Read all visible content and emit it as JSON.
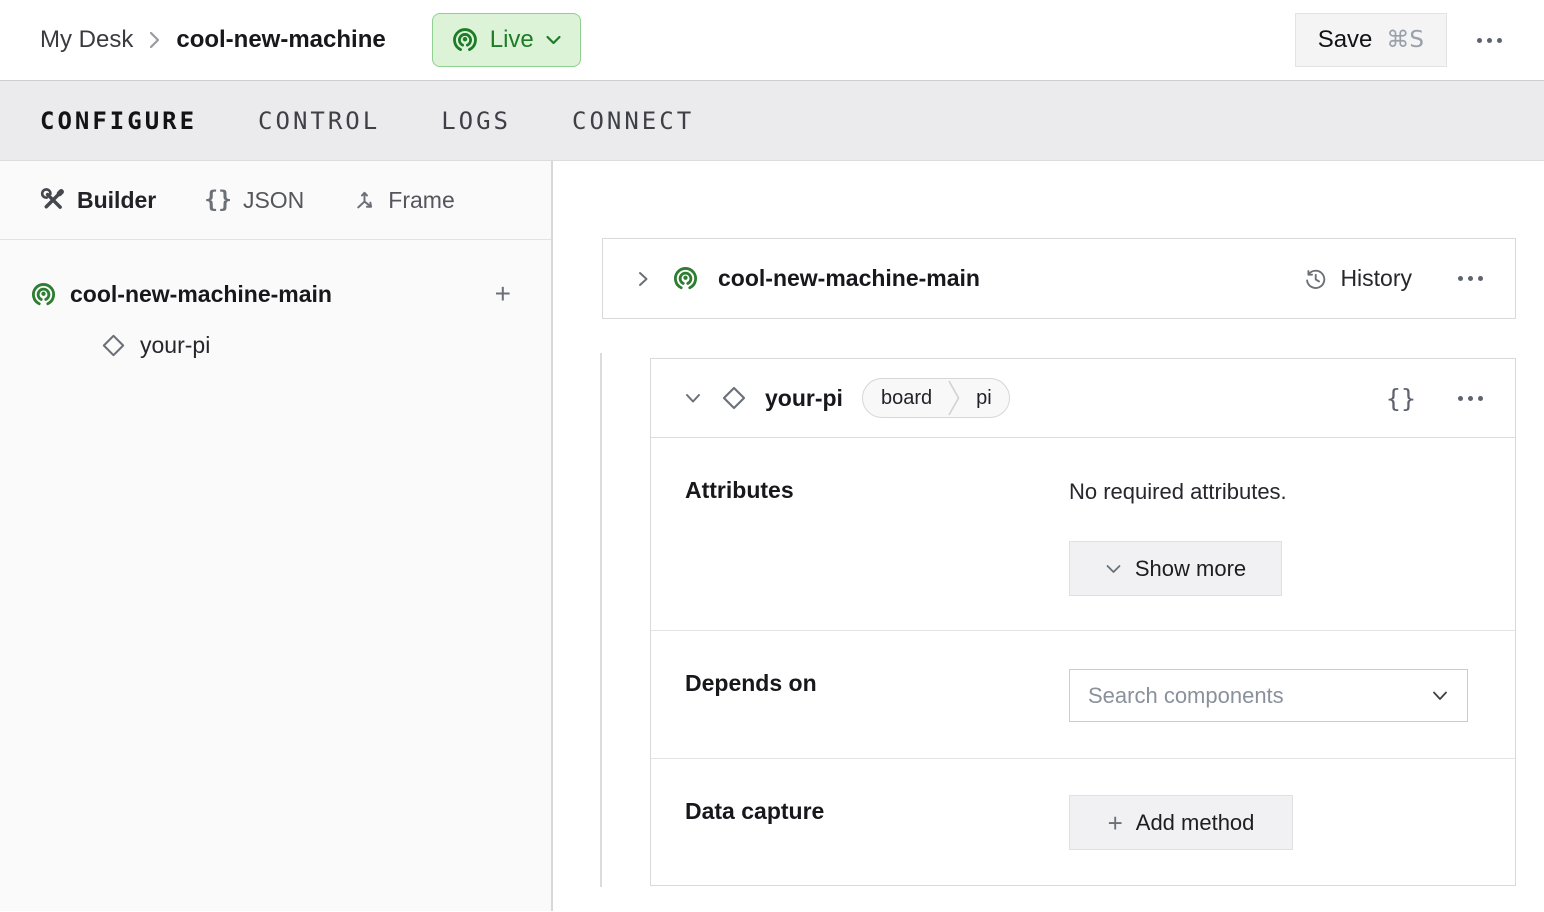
{
  "header": {
    "breadcrumb": {
      "parent": "My Desk",
      "title": "cool-new-machine"
    },
    "live_badge": {
      "label": "Live"
    },
    "save_button": {
      "label": "Save",
      "shortcut": "⌘S"
    }
  },
  "tabs": [
    {
      "label": "CONFIGURE",
      "active": true
    },
    {
      "label": "CONTROL",
      "active": false
    },
    {
      "label": "LOGS",
      "active": false
    },
    {
      "label": "CONNECT",
      "active": false
    }
  ],
  "sidebar": {
    "modes": [
      {
        "label": "Builder",
        "icon": "tools-icon",
        "active": true
      },
      {
        "label": "JSON",
        "icon_text": "{}",
        "active": false
      },
      {
        "label": "Frame",
        "icon": "frame-axes-icon",
        "active": false
      }
    ],
    "tree": {
      "machine": {
        "label": "cool-new-machine-main",
        "add_label": "+"
      },
      "component": {
        "label": "your-pi"
      }
    }
  },
  "main": {
    "machine_card": {
      "title": "cool-new-machine-main",
      "history_label": "History"
    },
    "component_card": {
      "title": "your-pi",
      "tags": [
        {
          "label": "board"
        },
        {
          "label": "pi"
        }
      ],
      "json_icon_text": "{}",
      "attributes": {
        "label": "Attributes",
        "empty_text": "No required attributes.",
        "show_more_label": "Show more"
      },
      "depends_on": {
        "label": "Depends on",
        "placeholder": "Search components"
      },
      "data_capture": {
        "label": "Data capture",
        "plus": "+",
        "add_method_label": "Add method"
      }
    }
  },
  "colors": {
    "accent_green": "#2e7d32",
    "live_bg": "#dcf3d8",
    "live_border": "#8fcf8f",
    "live_text": "#1e7b27",
    "tabbar_bg": "#ebebee",
    "sidebar_bg": "#fafafa",
    "card_border": "#d9d9db"
  }
}
